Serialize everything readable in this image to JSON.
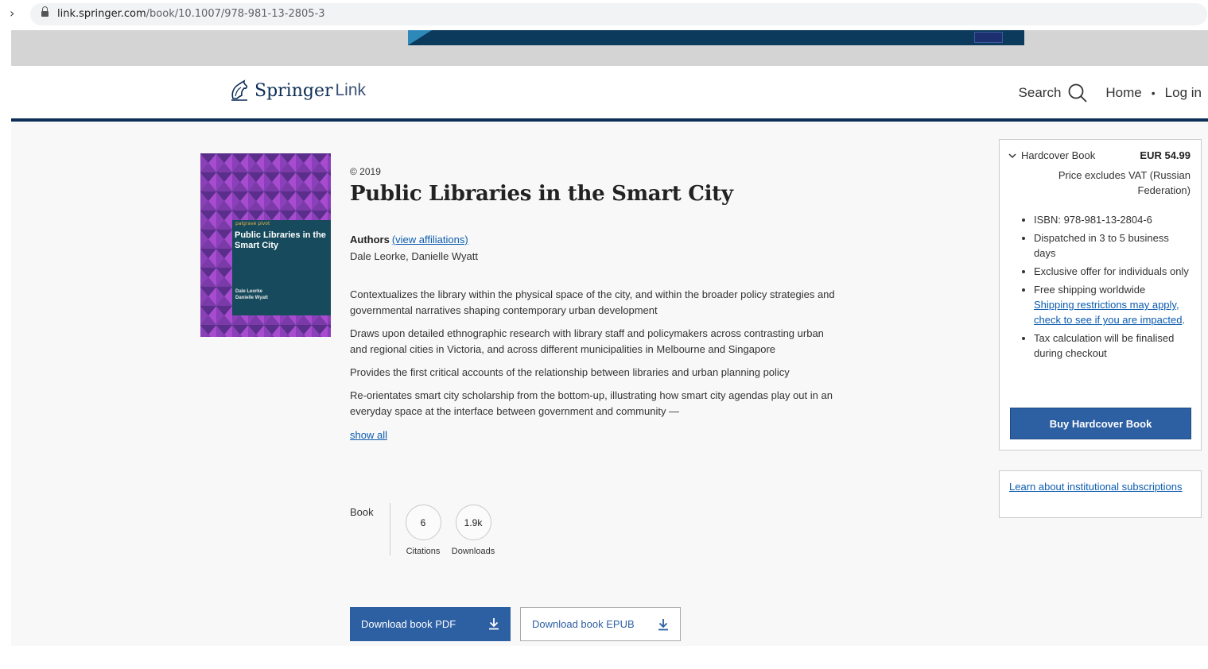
{
  "browser": {
    "url_host": "link.springer.com",
    "url_path": "/book/10.1007/978-981-13-2805-3"
  },
  "header": {
    "brand_name": "Springer",
    "brand_suffix": "Link",
    "search_label": "Search",
    "home_label": "Home",
    "separator": "•",
    "login_label": "Log in"
  },
  "book": {
    "copyright": "© 2019",
    "title": "Public Libraries in the Smart City",
    "authors_label": "Authors",
    "view_affiliations": "(view affiliations)",
    "author_names": "Dale Leorke, Danielle Wyatt",
    "bullets": [
      "Contextualizes the library within the physical space of the city, and within the broader policy strategies and governmental narratives shaping contemporary urban development",
      "Draws upon detailed ethnographic research with library staff and policymakers across contrasting urban and regional cities in Victoria, and across different municipalities in Melbourne and Singapore",
      "Provides the first critical accounts of the relationship between libraries and urban planning policy",
      "Re-orientates smart city scholarship from the bottom-up, illustrating how smart city agendas play out in an everyday space at the interface between government and community —"
    ],
    "show_all": "show all",
    "cover": {
      "series": "palgrave pivot",
      "title": "Public Libraries in the Smart City",
      "authors": [
        "Dale Leorke",
        "Danielle Wyatt"
      ]
    }
  },
  "metrics": {
    "type_label": "Book",
    "citations_value": "6",
    "citations_label": "Citations",
    "downloads_value": "1.9k",
    "downloads_label": "Downloads"
  },
  "downloads": {
    "pdf_label": "Download book PDF",
    "epub_label": "Download book EPUB"
  },
  "purchase": {
    "format": "Hardcover Book",
    "price": "EUR 54.99",
    "vat_note": "Price excludes VAT (Russian Federation)",
    "items": [
      "ISBN: 978-981-13-2804-6",
      "Dispatched in 3 to 5 business days",
      "Exclusive offer for individuals only",
      "Free shipping worldwide",
      "Tax calculation will be finalised during checkout"
    ],
    "shipping_link": "Shipping restrictions may apply, check to see if you are impacted",
    "shipping_link_suffix": ".",
    "buy_button": "Buy Hardcover Book"
  },
  "institutional": {
    "link": "Learn about institutional subscriptions"
  },
  "colors": {
    "brand_navy": "#0c2d56",
    "button_blue": "#2d5fa3",
    "link_blue": "#0c5cb0"
  }
}
